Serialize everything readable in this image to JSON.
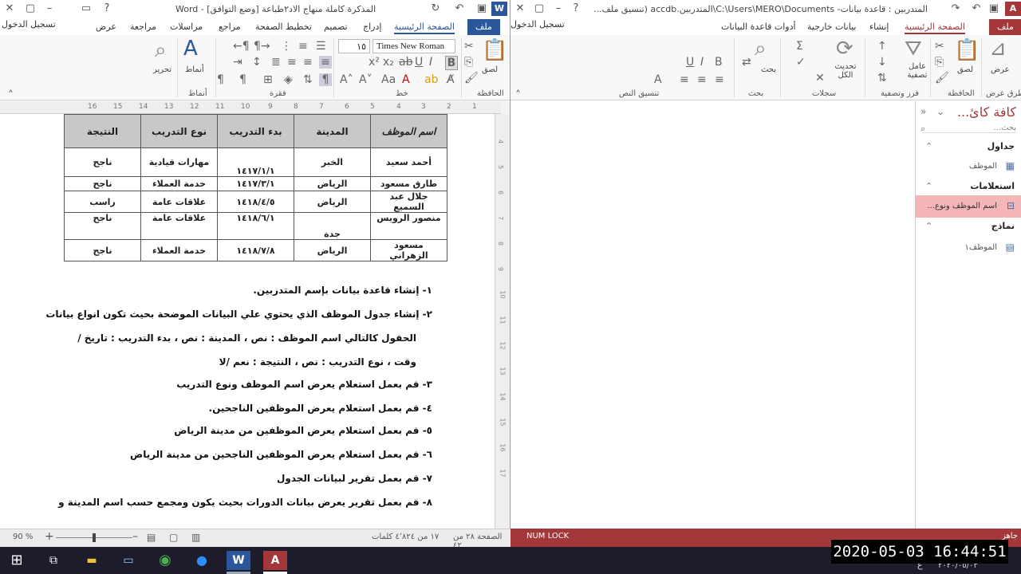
{
  "word": {
    "title": "المذكرة كاملة منهاج الاد٢طباعة [وضع التوافق] - Word",
    "tabs": [
      "ملف",
      "الصفحة الرئيسية",
      "إدراج",
      "تصميم",
      "تخطيط الصفحة",
      "مراجع",
      "مراسلات",
      "مراجعة",
      "عرض",
      "تسجيل الدخول"
    ],
    "font_name": "Times New Roman",
    "font_size": "١٥",
    "groups": [
      "الحافظة",
      "خط",
      "فقرة",
      "أنماط",
      "تحرير"
    ],
    "paste_label": "لصق",
    "styles_label": "أنماط",
    "edit_label": "تحرير",
    "ruler_h": [
      "1",
      "2",
      "3",
      "4",
      "5",
      "6",
      "7",
      "8",
      "9",
      "10",
      "11",
      "12",
      "13",
      "14",
      "15",
      "16"
    ],
    "ruler_v": [
      "4",
      "5",
      "6",
      "7",
      "8",
      "9",
      "10",
      "11",
      "12",
      "13",
      "14",
      "15",
      "16",
      "17"
    ],
    "table": {
      "headers": [
        "اسم الموظف",
        "المدينة",
        "بدء التدريب",
        "نوع التدريب",
        "النتيجة"
      ],
      "rows": [
        [
          "أحمد سعيد",
          "الخبر",
          "١٤١٧/١/١",
          "مهارات قيادية",
          "ناجح"
        ],
        [
          "طارق مسعود",
          "الرياض",
          "١٤١٧/٣/١",
          "خدمة العملاء",
          "ناجح"
        ],
        [
          "جلال عبد السميع",
          "الرياض",
          "١٤١٨/٤/٥",
          "علاقات عامة",
          "راسب"
        ],
        [
          "منصور الرويس",
          "جدة",
          "١٤١٨/٦/١",
          "علاقات عامة",
          "ناجح"
        ],
        [
          "مسعود الزهراني",
          "الرياض",
          "١٤١٨/٧/٨",
          "خدمة العملاء",
          "ناجح"
        ]
      ]
    },
    "questions": [
      "١- إنشاء قاعدة بيانات بإسم المتدربين.",
      "٢- إنشاء جدول الموظف الذي يحتوي علي البيانات الموضحة بحيث تكون انواع بيانات",
      "الحقول كالتالي     اسم الموظف : نص ،  المدينة : نص  ، بدء التدريب : تاريخ /",
      "وقت  ، نوع التدريب  : نص  ، النتيجة : نعم /لا",
      "٣- قم بعمل استعلام يعرض اسم الموظف ونوع التدريب",
      "٤- قم بعمل استعلام يعرض الموظفين الناجحين.",
      "٥- قم بعمل استعلام يعرض الموظفين من مدينة الرياض",
      "٦- قم بعمل استعلام يعرض الموظفين الناجحين من مدينة الرياض",
      "٧- قم بعمل تقرير لبيانات الجدول",
      "٨- قم بعمل تقرير يعرض بيانات الدورات بحيث يكون ومجمع حسب اسم المدينة و"
    ],
    "status": {
      "page": "الصفحة ٢٨ من ٤٢",
      "words": "١٧ من ٤٬٨٢٤ كلمات",
      "zoom": "90 %"
    }
  },
  "access": {
    "title": "المتدربين : قاعدة بيانات- C:\\Users\\MERO\\Documents\\المتدربين.accdb (تنسيق ملف...",
    "tabs": [
      "ملف",
      "الصفحة الرئيسية",
      "إنشاء",
      "بيانات خارجية",
      "أدوات قاعدة البيانات",
      "تسجيل الدخول"
    ],
    "groups": [
      "طرق عرض",
      "الحافظة",
      "فرز وتصفية",
      "سجلات",
      "بحث",
      "تنسيق النص"
    ],
    "buttons": {
      "view": "عرض",
      "paste": "لصق",
      "filter": "عامل تصفية",
      "refresh": "تحديث الكل",
      "find": "بحث"
    },
    "nav": {
      "title": "كافة كائ...",
      "search_placeholder": "بحث...",
      "sections": [
        {
          "name": "جداول",
          "items": [
            "الموظف"
          ]
        },
        {
          "name": "استعلامات",
          "items": [
            "اسم الموظف ونوع..."
          ]
        },
        {
          "name": "نماذج",
          "items": [
            "الموظف١"
          ]
        }
      ]
    },
    "status": {
      "left": "جاهز",
      "numlock": "NUM LOCK"
    }
  },
  "taskbar": {
    "clock": "2020-05-03  16:44:51",
    "date": "٢٠٢٠/٠٥/٠٣",
    "lang": "ع"
  },
  "colors": {
    "word_accent": "#2b579a",
    "access_accent": "#a4373a",
    "selected_nav": "#f4b6b8"
  }
}
